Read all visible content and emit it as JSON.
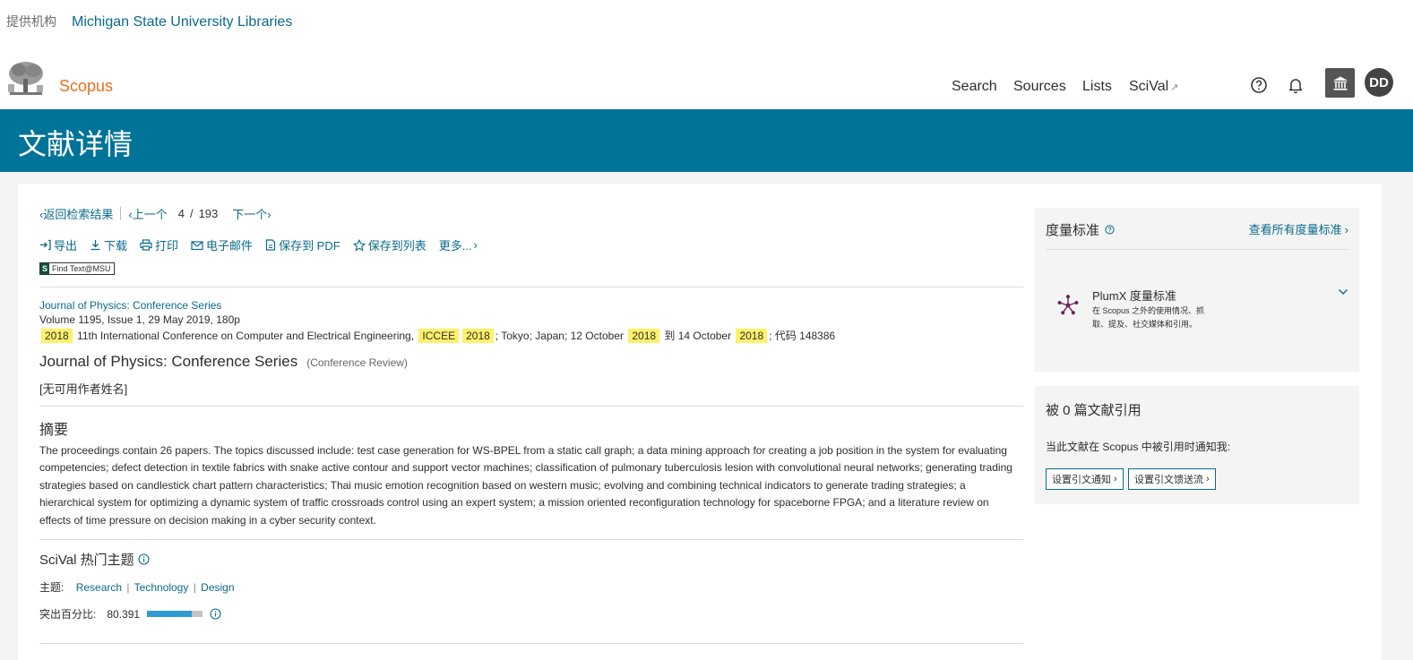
{
  "institution": {
    "label": "提供机构",
    "name": "Michigan State University Libraries"
  },
  "nav": {
    "brand": "Scopus",
    "links": [
      "Search",
      "Sources",
      "Lists",
      "SciVal"
    ],
    "scival_ext": "↗",
    "avatar_initials": "DD"
  },
  "banner": {
    "title": "文献详情"
  },
  "crumbs": {
    "back": "返回检索结果",
    "prev": "上一个",
    "current": "4",
    "slash": "/",
    "total": "193",
    "next": "下一个"
  },
  "toolbar": {
    "export": "导出",
    "download": "下载",
    "print": "打印",
    "email": "电子邮件",
    "save_pdf": "保存到 PDF",
    "save_list": "保存到列表",
    "more": "更多..."
  },
  "findtext": {
    "badge": "S",
    "label": "Find Text@MSU"
  },
  "source": {
    "journal": "Journal of Physics: Conference Series",
    "volume": "Volume 1195, Issue 1, 29 May 2019, 180p",
    "conf": {
      "year1": "2018",
      "text1": "11th International Conference on Computer and Electrical Engineering,",
      "acronym": "ICCEE",
      "year2": "2018",
      "text2": "; Tokyo; Japan; 12 October",
      "year3": "2018",
      "text3": "到 14 October",
      "year4": "2018",
      "text4": "; 代码 148386"
    }
  },
  "document": {
    "title": "Journal of Physics: Conference Series",
    "type": "(Conference Review)",
    "authors": "[无可用作者姓名]"
  },
  "abstract": {
    "heading": "摘要",
    "text": "The proceedings contain 26 papers. The topics discussed include: test case generation for WS-BPEL from a static call graph; a data mining approach for creating a job position in the system for evaluating competencies; defect detection in textile fabrics with snake active contour and support vector machines; classification of pulmonary tuberculosis lesion with convolutional neural networks; generating trading strategies based on candlestick chart pattern characteristics; Thai music emotion recognition based on western music; evolving and combining technical indicators to generate trading strategies; a hierarchical system for optimizing a dynamic system of traffic crossroads control using an expert system; a mission oriented reconfiguration technology for spaceborne FPGA; and a literature review on effects of time pressure on decision making in a cyber security context."
  },
  "scival": {
    "heading": "SciVal 热门主题",
    "topics_label": "主题:",
    "topics": [
      "Research",
      "Technology",
      "Design"
    ],
    "sep": "|",
    "percentile_label": "突出百分比:",
    "percentile": "80.391",
    "percentile_fraction": 0.80391,
    "bar_fill_color": "#2f9bd4"
  },
  "metrics": {
    "title": "度量标准",
    "view_all": "查看所有度量标准",
    "plumx_title": "PlumX 度量标准",
    "plumx_desc": "在 Scopus 之外的使用情况、抓取、提及、社交媒体和引用。"
  },
  "cited": {
    "title": "被 0 篇文献引用",
    "notify": "当此文献在 Scopus 中被引用时通知我:",
    "btn_alert": "设置引文通知",
    "btn_feed": "设置引文馈送流"
  },
  "colors": {
    "banner": "#007398",
    "brand": "#e9711c",
    "link": "#0a6a8c",
    "highlight": "#fff16a"
  }
}
